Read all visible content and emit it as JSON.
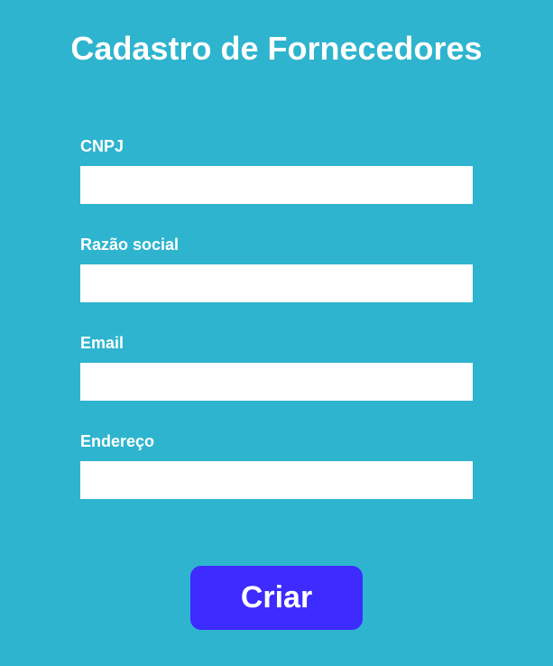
{
  "page": {
    "title": "Cadastro de Fornecedores"
  },
  "form": {
    "fields": [
      {
        "label": "CNPJ",
        "value": "",
        "placeholder": ""
      },
      {
        "label": "Razão social",
        "value": "",
        "placeholder": ""
      },
      {
        "label": "Email",
        "value": "",
        "placeholder": ""
      },
      {
        "label": "Endereço",
        "value": "",
        "placeholder": ""
      }
    ],
    "submit_label": "Criar"
  },
  "colors": {
    "background": "#2eb4cf",
    "button": "#3d2bff",
    "text": "#ffffff",
    "input_background": "#ffffff"
  }
}
